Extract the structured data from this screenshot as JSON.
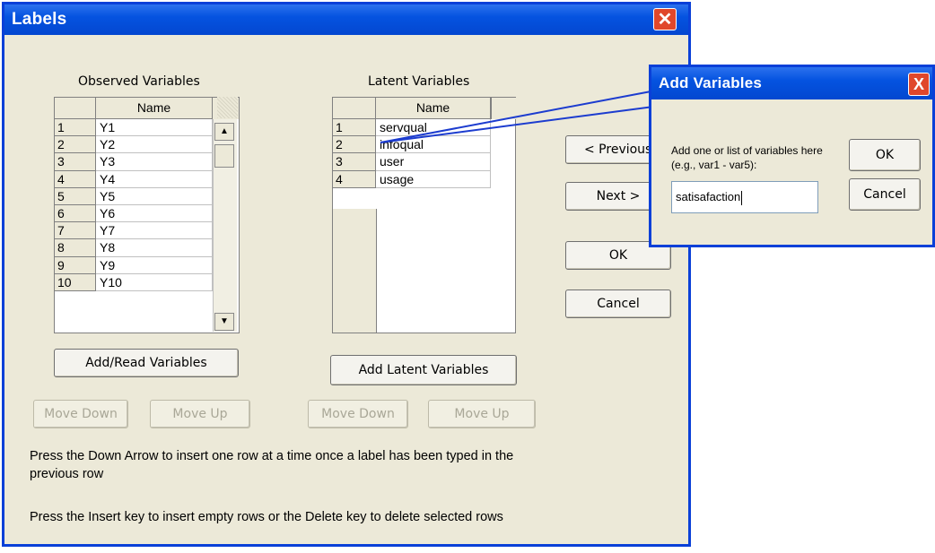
{
  "labels_window": {
    "title": "Labels",
    "close_glyph": "✕",
    "observed": {
      "heading": "Observed Variables",
      "column": "Name",
      "rows": [
        {
          "n": "1",
          "name": "Y1"
        },
        {
          "n": "2",
          "name": "Y2"
        },
        {
          "n": "3",
          "name": "Y3"
        },
        {
          "n": "4",
          "name": "Y4"
        },
        {
          "n": "5",
          "name": "Y5"
        },
        {
          "n": "6",
          "name": "Y6"
        },
        {
          "n": "7",
          "name": "Y7"
        },
        {
          "n": "8",
          "name": "Y8"
        },
        {
          "n": "9",
          "name": "Y9"
        },
        {
          "n": "10",
          "name": "Y10"
        }
      ],
      "add_button": "Add/Read Variables",
      "move_down": "Move Down",
      "move_up": "Move Up"
    },
    "latent": {
      "heading": "Latent Variables",
      "column": "Name",
      "rows": [
        {
          "n": "1",
          "name": "servqual"
        },
        {
          "n": "2",
          "name": "infoqual"
        },
        {
          "n": "3",
          "name": "user"
        },
        {
          "n": "4",
          "name": "usage"
        }
      ],
      "add_button": "Add Latent Variables",
      "move_down": "Move Down",
      "move_up": "Move Up"
    },
    "nav": {
      "previous": "< Previous",
      "next": "Next >",
      "ok": "OK",
      "cancel": "Cancel"
    },
    "help_text_1a": "Press the Down Arrow to insert one row at a time once a label has been typed in the",
    "help_text_1b": "previous row",
    "help_text_2": "Press the Insert key to insert empty rows or the Delete key to delete selected rows"
  },
  "add_variables_dialog": {
    "title": "Add Variables",
    "close_glyph": "X",
    "prompt_line1": "Add one or list of variables here",
    "prompt_line2": "(e.g., var1 - var5):",
    "input_value": "satisafaction",
    "ok": "OK",
    "cancel": "Cancel"
  },
  "colors": {
    "titlebar": "#0553e0",
    "window_bg": "#ece9d8",
    "close_red": "#e0472b"
  }
}
